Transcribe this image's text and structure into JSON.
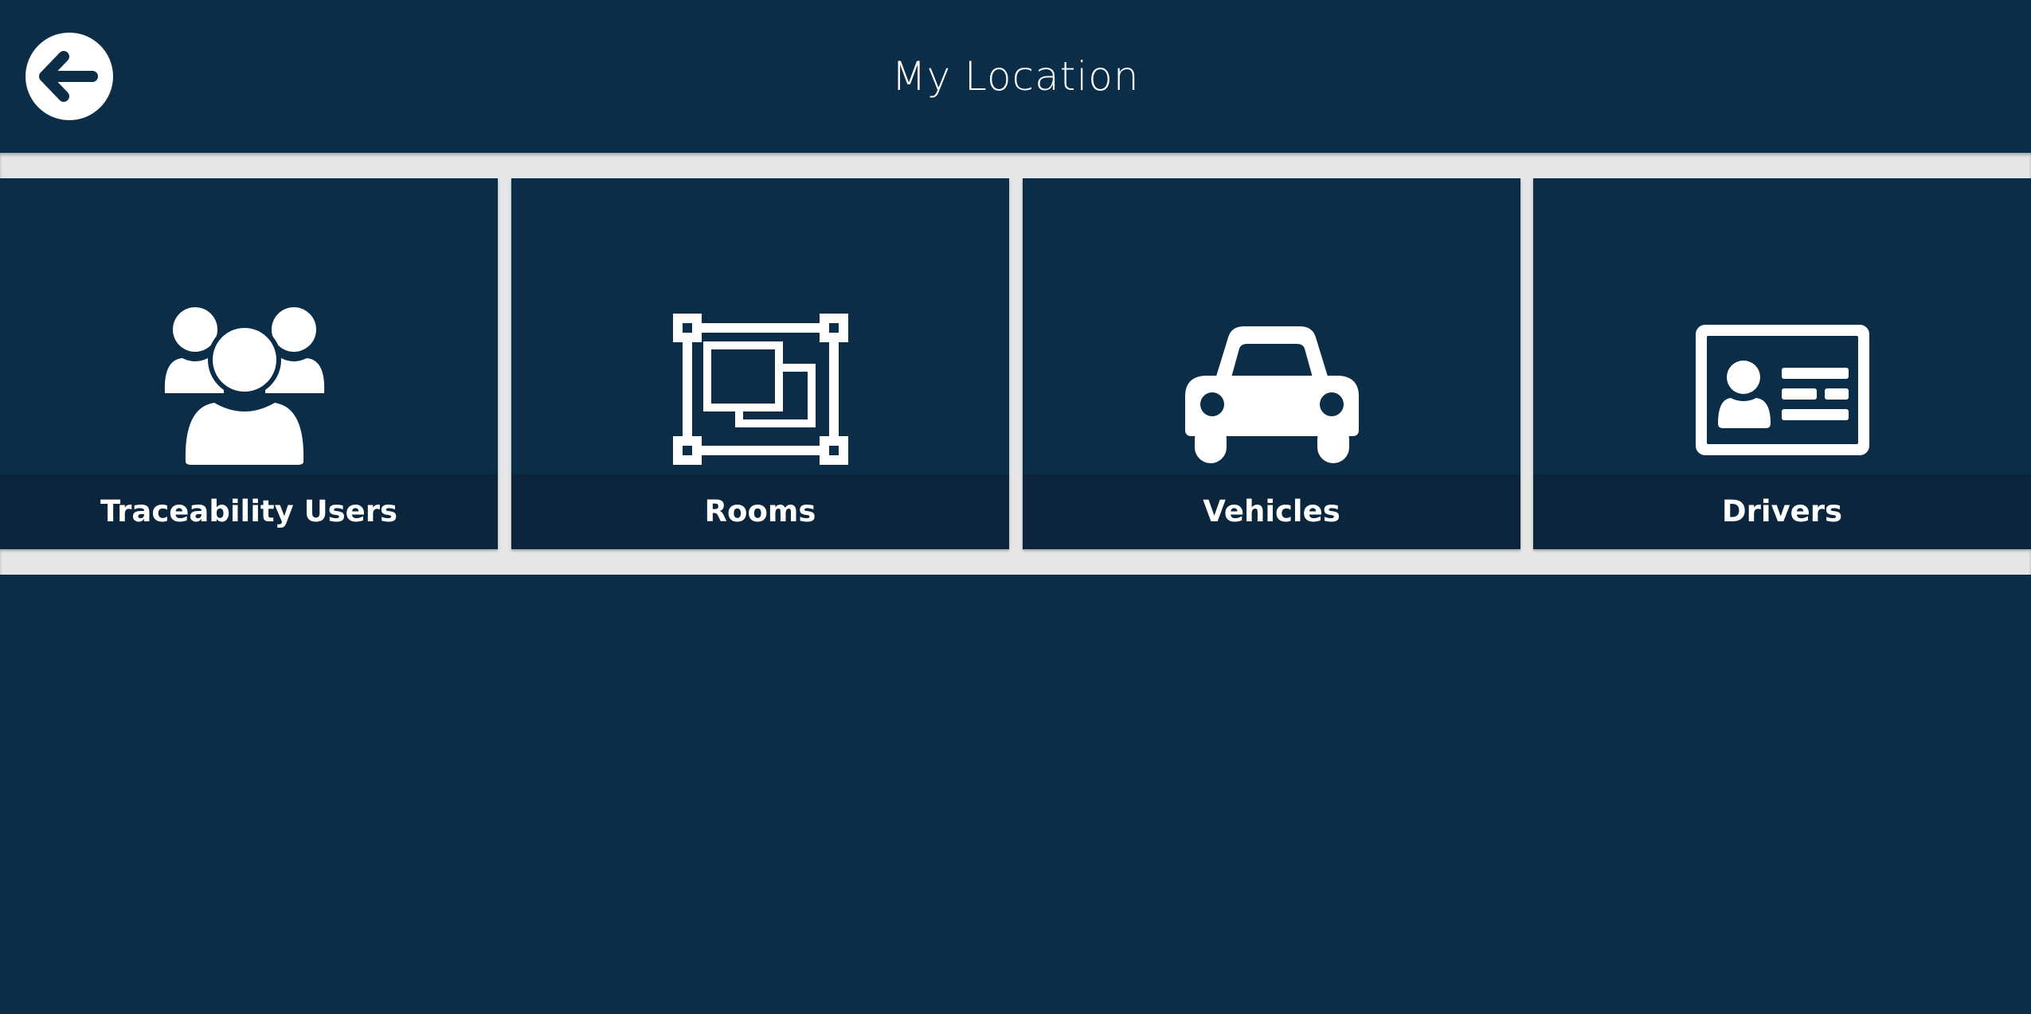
{
  "header": {
    "title": "My Location",
    "back_icon": "arrow-left-circle-icon"
  },
  "colors": {
    "background": "#0c2d48",
    "tile_label_bar": "#0a253c",
    "band": "#e6e6e6",
    "foreground": "#ffffff"
  },
  "tiles": [
    {
      "label": "Traceability Users",
      "icon": "users-group-icon"
    },
    {
      "label": "Rooms",
      "icon": "room-layout-icon"
    },
    {
      "label": "Vehicles",
      "icon": "car-icon"
    },
    {
      "label": "Drivers",
      "icon": "id-card-icon"
    }
  ]
}
